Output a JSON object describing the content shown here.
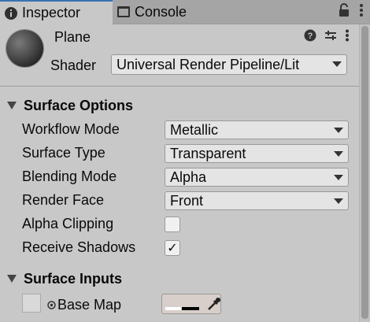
{
  "tabs": [
    {
      "label": "Inspector",
      "icon": "info-icon",
      "active": true
    },
    {
      "label": "Console",
      "icon": "console-icon",
      "active": false
    }
  ],
  "header": {
    "object_name": "Plane",
    "shader_label": "Shader",
    "shader_value": "Universal Render Pipeline/Lit"
  },
  "surface_options": {
    "title": "Surface Options",
    "props": [
      {
        "label": "Workflow Mode",
        "value": "Metallic"
      },
      {
        "label": "Surface Type",
        "value": "Transparent"
      },
      {
        "label": "Blending Mode",
        "value": "Alpha"
      },
      {
        "label": "Render Face",
        "value": "Front"
      }
    ],
    "alpha_clipping": {
      "label": "Alpha Clipping",
      "checked": false
    },
    "receive_shadows": {
      "label": "Receive Shadows",
      "checked": true,
      "mark": "✓"
    }
  },
  "surface_inputs": {
    "title": "Surface Inputs",
    "base_map_label": "Base Map",
    "base_map_color": "#d8cfca"
  },
  "colors": {
    "tab_accent": "#3a72b0",
    "panel_bg": "#c8c8c8"
  }
}
